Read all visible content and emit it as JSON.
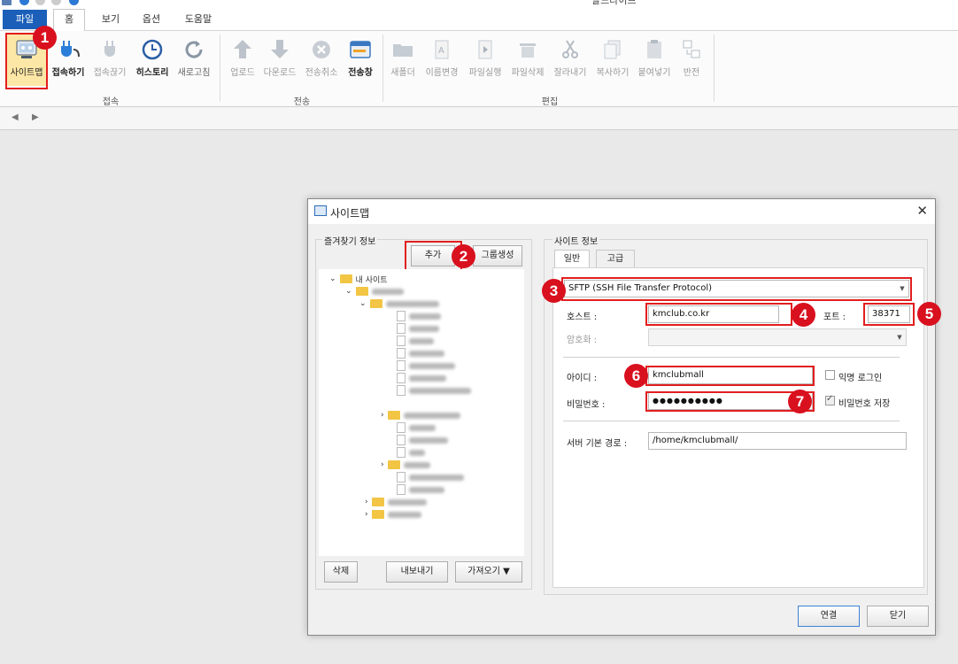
{
  "window": {
    "title": "알드라이브"
  },
  "tabs": {
    "file": "파일",
    "home": "홈",
    "view": "보기",
    "options": "옵션",
    "help": "도움말"
  },
  "ribbon": {
    "sitemap": "사이트맵",
    "connect": "접속하기",
    "disconnect": "접속끊기",
    "history": "히스토리",
    "refresh": "새로고침",
    "group_connect": "접속",
    "upload": "업로드",
    "download": "다운로드",
    "cancel_transfer": "전송취소",
    "transfer_window": "전송창",
    "group_transfer": "전송",
    "new_folder": "새폴더",
    "rename": "이름변경",
    "run_file": "파일실행",
    "delete_file": "파일삭제",
    "cut": "잘라내기",
    "copy": "복사하기",
    "paste": "붙여넣기",
    "invert": "반전",
    "group_edit": "편집"
  },
  "nav": {
    "back": "◀",
    "forward": "▶"
  },
  "dialog": {
    "title": "사이트맵",
    "favorites_legend": "즐겨찾기 정보",
    "add_label": "추가",
    "group_create_label": "그룹생성",
    "tree_root": "내 사이트",
    "delete_label": "삭제",
    "export_label": "내보내기",
    "import_label": "가져오기 ▼",
    "site_info_legend": "사이트 정보",
    "tab_general": "일반",
    "tab_advanced": "고급",
    "protocol": "SFTP (SSH File Transfer Protocol)",
    "host_label": "호스트 :",
    "host_value": "kmclub.co.kr",
    "port_label": "포트 :",
    "port_value": "38371",
    "encryption_label": "암호화 :",
    "id_label": "아이디 :",
    "id_value": "kmclubmall",
    "anonymous_label": "익명 로그인",
    "password_label": "비밀번호 :",
    "password_value": "●●●●●●●●●●",
    "save_password_label": "비밀번호 저장",
    "server_path_label": "서버 기본 경로 :",
    "server_path_value": "/home/kmclubmall/",
    "connect_label": "연결",
    "close_label": "닫기"
  },
  "badges": [
    "1",
    "2",
    "3",
    "4",
    "5",
    "6",
    "7"
  ]
}
